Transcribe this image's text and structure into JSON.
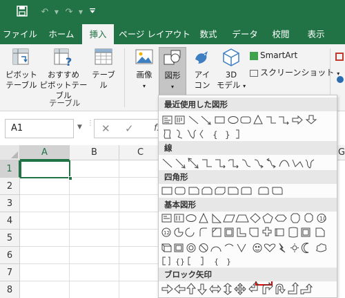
{
  "titlebar": {
    "save_icon": "save-icon",
    "undo_icon": "undo-icon",
    "redo_icon": "redo-icon",
    "qat_icon": "customize-qat-icon",
    "bg_color": "#217346"
  },
  "tabs": [
    {
      "label": "ファイル"
    },
    {
      "label": "ホーム"
    },
    {
      "label": "挿入"
    },
    {
      "label": "ページ レイアウト"
    },
    {
      "label": "数式"
    },
    {
      "label": "データ"
    },
    {
      "label": "校閲"
    },
    {
      "label": "表示"
    }
  ],
  "ribbon": {
    "pivot_line1": "ピボット",
    "pivot_line2": "テーブル",
    "recpivot_line1": "おすすめ",
    "recpivot_line2": "ピボットテーブル",
    "table_label": "テーブル",
    "table_group_label": "テーブル",
    "picture_label": "画像",
    "shapes_label": "図形",
    "icons_line1": "アイ",
    "icons_line2": "コン",
    "model_line1": "3D",
    "model_line2": "モデル",
    "smartart_label": "SmartArt",
    "screenshot_label": "スクリーンショット"
  },
  "formula_bar": {
    "name_box": "A1",
    "fx": "fx"
  },
  "grid": {
    "columns": [
      "A",
      "B",
      "C"
    ],
    "rows": [
      "1",
      "2",
      "3",
      "4",
      "5",
      "6",
      "7",
      "8"
    ],
    "selected_cell": "A1",
    "partial_column": "G"
  },
  "shapes_panel": {
    "categories": [
      {
        "title": "最近使用した図形"
      },
      {
        "title": "線"
      },
      {
        "title": "四角形"
      },
      {
        "title": "基本図形"
      },
      {
        "title": "ブロック矢印"
      }
    ],
    "highlighted_shape": "rounded-top-corners-rectangle",
    "highlight_color": "#e00000"
  }
}
